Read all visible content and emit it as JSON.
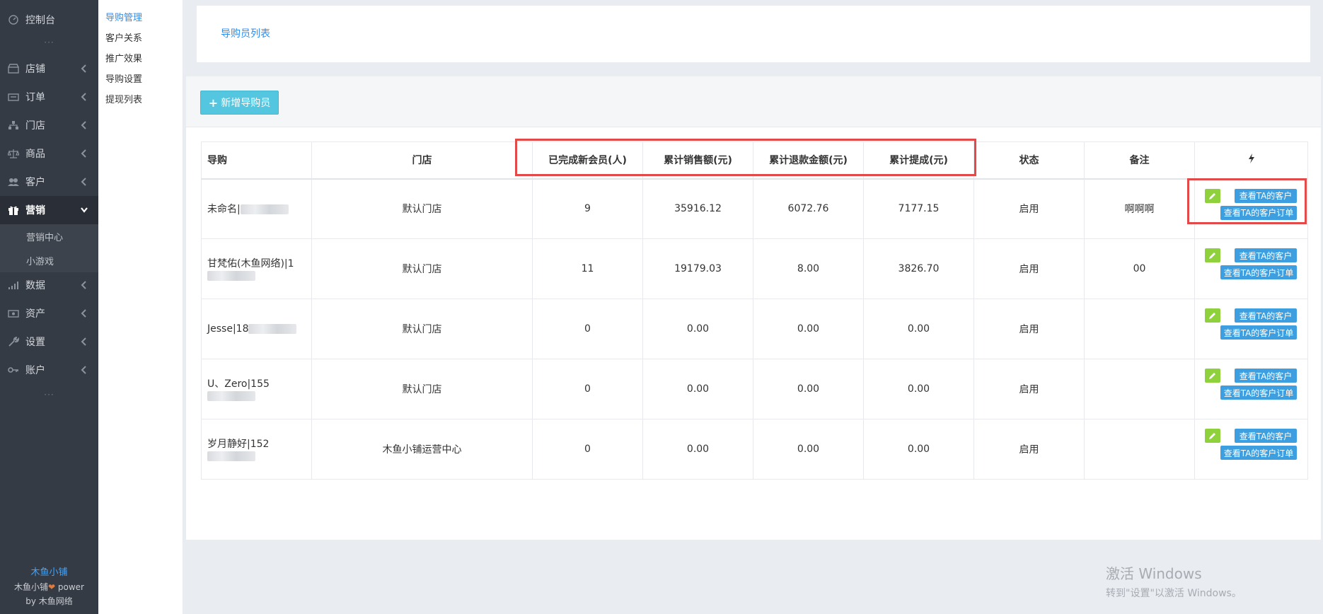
{
  "sidebar": {
    "dashboard": "控制台",
    "items": [
      {
        "label": "店铺",
        "icon": "shop-icon"
      },
      {
        "label": "订单",
        "icon": "order-icon"
      },
      {
        "label": "门店",
        "icon": "store-tree-icon"
      },
      {
        "label": "商品",
        "icon": "scale-icon"
      },
      {
        "label": "客户",
        "icon": "users-icon"
      },
      {
        "label": "营销",
        "icon": "gift-icon"
      },
      {
        "label": "数据",
        "icon": "bar-chart-icon"
      },
      {
        "label": "资产",
        "icon": "money-icon"
      },
      {
        "label": "设置",
        "icon": "wrench-icon"
      },
      {
        "label": "账户",
        "icon": "key-icon"
      }
    ],
    "sub_items": [
      "营销中心",
      "小游戏"
    ],
    "dots": "···",
    "footer": {
      "brand": "木鱼小铺",
      "line2_prefix": "木鱼小铺",
      "line2_suffix": " power",
      "line3": "by 木鱼网络"
    }
  },
  "submenu": {
    "items": [
      "导购管理",
      "客户关系",
      "推广效果",
      "导购设置",
      "提现列表"
    ]
  },
  "topcard": {
    "link": "导购员列表"
  },
  "toolbar": {
    "add_label": "新增导购员"
  },
  "table": {
    "headers": [
      "导购",
      "门店",
      "已完成新会员(人)",
      "累计销售额(元)",
      "累计退款金额(元)",
      "累计提成(元)",
      "状态",
      "备注"
    ],
    "rows": [
      {
        "name": "未命名|",
        "store": "默认门店",
        "members": "9",
        "sales": "35916.12",
        "refund": "6072.76",
        "commission": "7177.15",
        "status": "启用",
        "remark": "啊啊啊"
      },
      {
        "name": "甘梵佑(木鱼网络)|1",
        "store": "默认门店",
        "members": "11",
        "sales": "19179.03",
        "refund": "8.00",
        "commission": "3826.70",
        "status": "启用",
        "remark": "00"
      },
      {
        "name": "Jesse|18",
        "store": "默认门店",
        "members": "0",
        "sales": "0.00",
        "refund": "0.00",
        "commission": "0.00",
        "status": "启用",
        "remark": ""
      },
      {
        "name": "U、Zero|155",
        "store": "默认门店",
        "members": "0",
        "sales": "0.00",
        "refund": "0.00",
        "commission": "0.00",
        "status": "启用",
        "remark": ""
      },
      {
        "name": "岁月静好|152",
        "store": "木鱼小铺运营中心",
        "members": "0",
        "sales": "0.00",
        "refund": "0.00",
        "commission": "0.00",
        "status": "启用",
        "remark": ""
      }
    ],
    "actions": {
      "view_customers": "查看TA的客户",
      "view_orders": "查看TA的客户订单"
    }
  },
  "watermark": {
    "title": "激活 Windows",
    "subtitle": "转到\"设置\"以激活 Windows。"
  }
}
